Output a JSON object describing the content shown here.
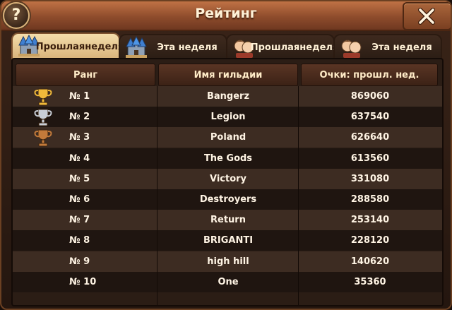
{
  "window": {
    "title": "Рейтинг"
  },
  "tabs": [
    {
      "label_line1": "Прошлая",
      "label_line2": "неделя",
      "icon": "guild-castle-icon",
      "active": true
    },
    {
      "label_line1": "Эта неделя",
      "label_line2": "",
      "icon": "guild-castle-icon",
      "active": false
    },
    {
      "label_line1": "Прошлая",
      "label_line2": "неделя",
      "icon": "heroes-portrait-icon",
      "active": false
    },
    {
      "label_line1": "Эта неделя",
      "label_line2": "",
      "icon": "heroes-portrait-icon",
      "active": false
    }
  ],
  "table": {
    "headers": {
      "rank": "Ранг",
      "guild": "Имя гильдии",
      "points": "Очки: прошл. нед."
    },
    "rows": [
      {
        "rank": "№ 1",
        "guild": "Bangerz",
        "points": "869060",
        "trophy": "gold-trophy-icon"
      },
      {
        "rank": "№ 2",
        "guild": "Legion",
        "points": "637540",
        "trophy": "silver-trophy-icon"
      },
      {
        "rank": "№ 3",
        "guild": "Poland",
        "points": "626640",
        "trophy": "bronze-trophy-icon"
      },
      {
        "rank": "№ 4",
        "guild": "The  Gods",
        "points": "613560",
        "trophy": ""
      },
      {
        "rank": "№ 5",
        "guild": "Victory",
        "points": "331080",
        "trophy": ""
      },
      {
        "rank": "№ 6",
        "guild": "Destroyers",
        "points": "288580",
        "trophy": ""
      },
      {
        "rank": "№ 7",
        "guild": "Return",
        "points": "253140",
        "trophy": ""
      },
      {
        "rank": "№ 8",
        "guild": "BRIGANTI",
        "points": "228120",
        "trophy": ""
      },
      {
        "rank": "№ 9",
        "guild": "high  hill",
        "points": "140620",
        "trophy": ""
      },
      {
        "rank": "№ 10",
        "guild": "One",
        "points": "35360",
        "trophy": ""
      }
    ]
  },
  "colors": {
    "gold": "#f0b93a",
    "silver": "#c9ced6",
    "bronze": "#c27a3a"
  }
}
